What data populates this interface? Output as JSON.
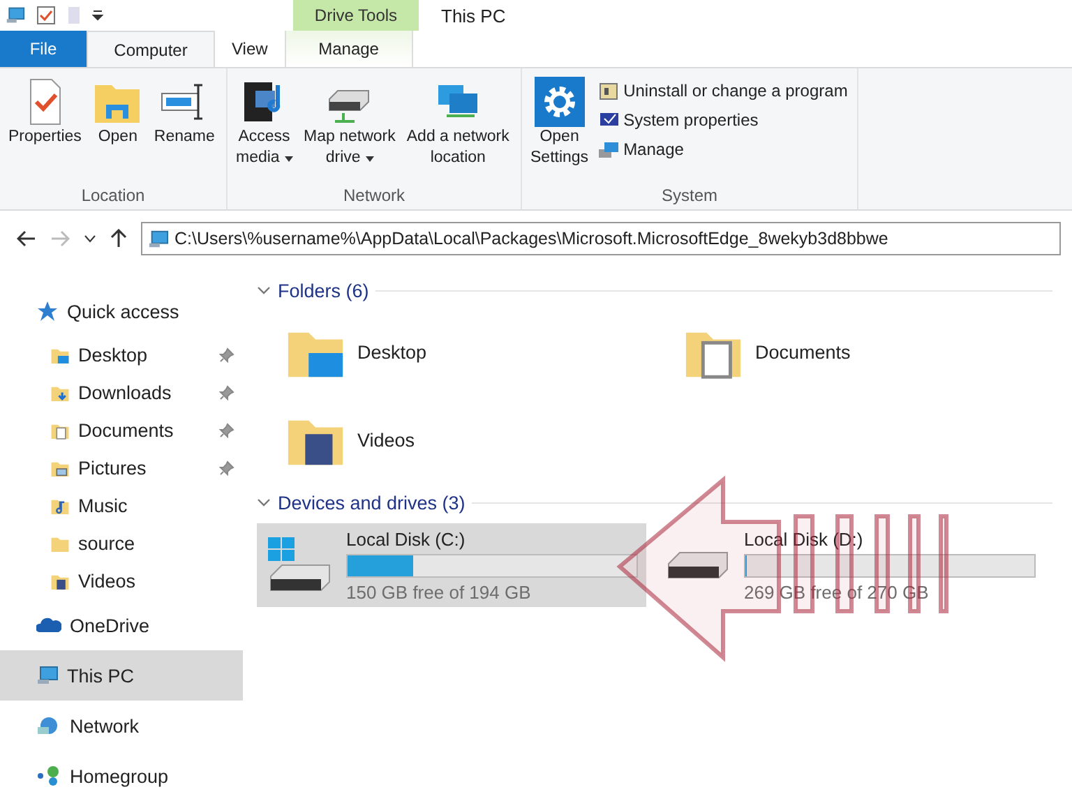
{
  "title_bar": {
    "context_tab": "Drive Tools",
    "title": "This PC"
  },
  "ribbon_tabs": [
    {
      "label": "File",
      "kind": "file",
      "selected": false
    },
    {
      "label": "Computer",
      "kind": "normal",
      "selected": true
    },
    {
      "label": "View",
      "kind": "normal",
      "selected": false
    },
    {
      "label": "Manage",
      "kind": "context",
      "selected": false
    }
  ],
  "ribbon_groups": [
    {
      "label": "Location",
      "commands": [
        {
          "kind": "large",
          "label": "Properties"
        },
        {
          "kind": "large",
          "label": "Open"
        },
        {
          "kind": "large",
          "label": "Rename"
        }
      ]
    },
    {
      "label": "Network",
      "commands": [
        {
          "kind": "large",
          "label": "Access\nmedia",
          "dropdown": true
        },
        {
          "kind": "large",
          "label": "Map network\ndrive",
          "dropdown": true
        },
        {
          "kind": "large",
          "label": "Add a network\nlocation",
          "dropdown": false
        }
      ]
    },
    {
      "label": "System",
      "commands": [
        {
          "kind": "large",
          "label": "Open\nSettings"
        },
        {
          "kind": "small",
          "label": "Uninstall or change a program"
        },
        {
          "kind": "small",
          "label": "System properties"
        },
        {
          "kind": "small",
          "label": "Manage"
        }
      ]
    }
  ],
  "address_bar": {
    "path": "C:\\Users\\%username%\\AppData\\Local\\Packages\\Microsoft.MicrosoftEdge_8wekyb3d8bbwe"
  },
  "sidebar": {
    "items": [
      {
        "label": "Quick access",
        "selected": false,
        "children": [
          {
            "label": "Desktop",
            "pinned": true,
            "selected": false
          },
          {
            "label": "Downloads",
            "pinned": true,
            "selected": false
          },
          {
            "label": "Documents",
            "pinned": true,
            "selected": false
          },
          {
            "label": "Pictures",
            "pinned": true,
            "selected": false
          },
          {
            "label": "Music",
            "pinned": false,
            "selected": false
          },
          {
            "label": "source",
            "pinned": false,
            "selected": false
          },
          {
            "label": "Videos",
            "pinned": false,
            "selected": false
          }
        ]
      },
      {
        "label": "OneDrive",
        "selected": false
      },
      {
        "label": "This PC",
        "selected": true
      },
      {
        "label": "Network",
        "selected": false
      },
      {
        "label": "Homegroup",
        "selected": false
      }
    ]
  },
  "sections": [
    {
      "title": "Folders (6)",
      "expanded": true,
      "kind": "folders",
      "items": [
        {
          "label": "Desktop"
        },
        {
          "label": "Documents"
        },
        {
          "label": "Videos"
        }
      ]
    },
    {
      "title": "Devices and drives (3)",
      "expanded": true,
      "kind": "drives",
      "items": [
        {
          "label": "Local Disk (C:)",
          "free": "150 GB free of 194 GB",
          "level": 0.227,
          "selected": true
        },
        {
          "label": "Local Disk (D:)",
          "free": "269 GB free of 270 GB",
          "level": 0.004,
          "selected": false
        }
      ]
    }
  ]
}
